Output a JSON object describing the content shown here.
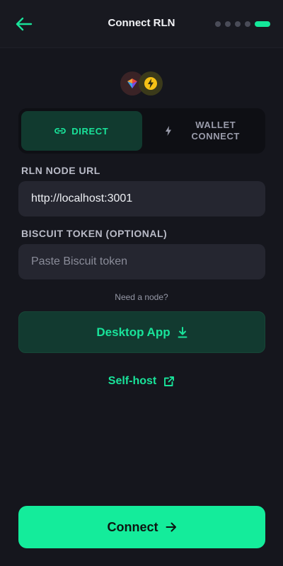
{
  "header": {
    "title": "Connect RLN",
    "back_icon": "arrow-left-icon",
    "steps_total": 5,
    "steps_current": 5
  },
  "colors": {
    "accent": "#14ec9b",
    "background": "#15161d",
    "field": "#252630"
  },
  "mode_toggle": {
    "direct_label": "DIRECT",
    "direct_icon": "link-icon",
    "wallet_label_line1": "WALLET",
    "wallet_label_line2": "CONNECT",
    "wallet_icon": "lightning-icon",
    "selected": "direct"
  },
  "node_url": {
    "label": "RLN NODE URL",
    "value": "http://localhost:3001"
  },
  "biscuit": {
    "label": "BISCUIT TOKEN (OPTIONAL)",
    "placeholder": "Paste Biscuit token",
    "value": ""
  },
  "help": {
    "need_node": "Need a node?",
    "desktop_app_label": "Desktop App",
    "desktop_icon": "download-icon",
    "self_host_label": "Self-host",
    "self_host_icon": "external-link-icon"
  },
  "footer": {
    "connect_label": "Connect",
    "connect_icon": "arrow-right-icon"
  }
}
